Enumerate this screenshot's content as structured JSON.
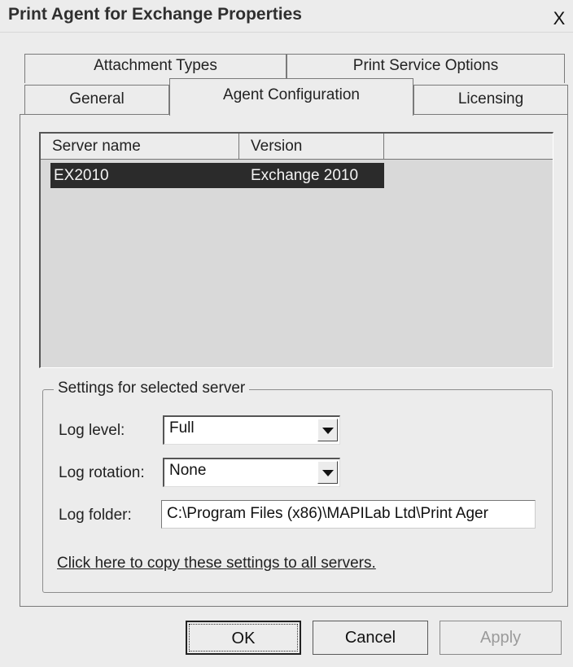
{
  "window": {
    "title": "Print Agent for Exchange Properties",
    "close_glyph": "X"
  },
  "tabs": {
    "row1": [
      {
        "label": "Attachment Types"
      },
      {
        "label": "Print Service Options"
      }
    ],
    "row2": [
      {
        "label": "General"
      },
      {
        "label": "Agent Configuration",
        "active": true
      },
      {
        "label": "Licensing"
      }
    ]
  },
  "server_list": {
    "columns": [
      "Server name",
      "Version"
    ],
    "rows": [
      {
        "server": "EX2010",
        "version": "Exchange 2010",
        "selected": true
      }
    ]
  },
  "settings": {
    "group_title": "Settings for selected server",
    "log_level": {
      "label": "Log level:",
      "value": "Full"
    },
    "log_rotation": {
      "label": "Log rotation:",
      "value": "None"
    },
    "log_folder": {
      "label": "Log folder:",
      "value": "C:\\Program Files (x86)\\MAPILab Ltd\\Print Ager"
    },
    "copy_link": "Click here to copy these settings to all servers."
  },
  "buttons": {
    "ok": "OK",
    "cancel": "Cancel",
    "apply": "Apply"
  },
  "colors": {
    "selection": "#2b2b2b",
    "list_bg": "#d9d9d9",
    "window_bg": "#ececec"
  }
}
